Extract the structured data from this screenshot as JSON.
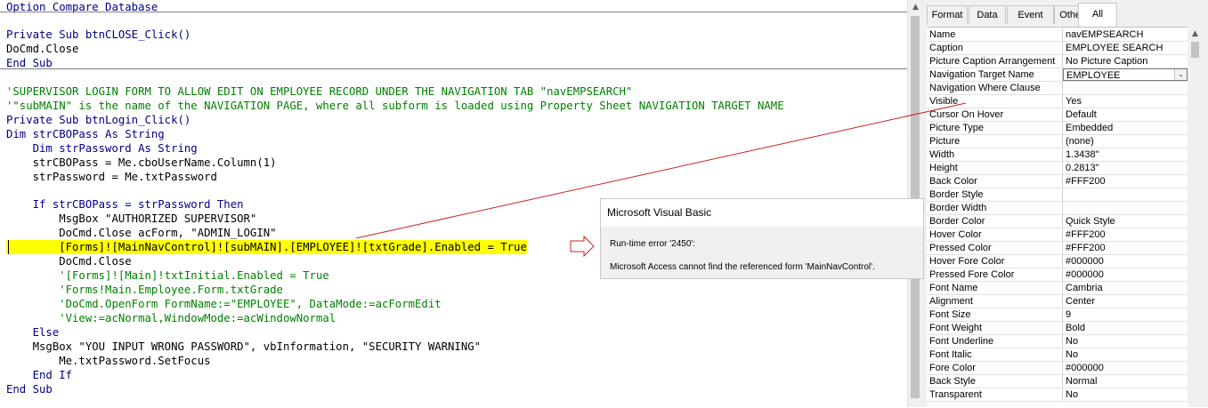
{
  "editor": {
    "lines": [
      {
        "text": "Option Compare Database",
        "style": "kw"
      },
      {
        "text": "Private Sub btnCLOSE_Click()",
        "style": "kw"
      },
      {
        "text": "DoCmd.Close",
        "style": ""
      },
      {
        "text": "End Sub",
        "style": "kw"
      },
      {
        "text": "'SUPERVISOR LOGIN FORM TO ALLOW EDIT ON EMPLOYEE RECORD UNDER THE NAVIGATION TAB \"navEMPSEARCH\"",
        "style": "cm"
      },
      {
        "text": "'\"subMAIN\" is the name of the NAVIGATION PAGE, where all subform is loaded using Property Sheet NAVIGATION TARGET NAME",
        "style": "cm"
      },
      {
        "text": "Private Sub btnLogin_Click()",
        "style": "kw"
      },
      {
        "text": "Dim strCBOPass As String",
        "style": "kw"
      },
      {
        "text": "    Dim strPassword As String",
        "style": "kw"
      },
      {
        "text": "    strCBOPass = Me.cboUserName.Column(1)",
        "style": ""
      },
      {
        "text": "    strPassword = Me.txtPassword",
        "style": ""
      },
      {
        "text": "    If strCBOPass = strPassword Then",
        "style": "kw"
      },
      {
        "text": "        MsgBox \"AUTHORIZED SUPERVISOR\"",
        "style": ""
      },
      {
        "text": "        DoCmd.Close acForm, \"ADMIN_LOGIN\"",
        "style": ""
      },
      {
        "text": "        [Forms]![MainNavControl]![subMAIN].[EMPLOYEE]![txtGrade].Enabled = True",
        "style": "hl"
      },
      {
        "text": "        DoCmd.Close",
        "style": ""
      },
      {
        "text": "        '[Forms]![Main]!txtInitial.Enabled = True",
        "style": "cm"
      },
      {
        "text": "        'Forms!Main.Employee.Form.txtGrade",
        "style": "cm"
      },
      {
        "text": "        'DoCmd.OpenForm FormName:=\"EMPLOYEE\", DataMode:=acFormEdit",
        "style": "cm"
      },
      {
        "text": "        'View:=acNormal,WindowMode:=acWindowNormal",
        "style": "cm"
      },
      {
        "text": "    Else",
        "style": "kw"
      },
      {
        "text": "    MsgBox \"YOU INPUT WRONG PASSWORD\", vbInformation, \"SECURITY WARNING\"",
        "style": ""
      },
      {
        "text": "        Me.txtPassword.SetFocus",
        "style": ""
      },
      {
        "text": "    End If",
        "style": "kw"
      },
      {
        "text": "End Sub",
        "style": "kw"
      }
    ]
  },
  "property_sheet": {
    "tabs": [
      "Format",
      "Data",
      "Event",
      "Other",
      "All"
    ],
    "active_tab": "All",
    "rows": [
      {
        "name": "Name",
        "value": "navEMPSEARCH"
      },
      {
        "name": "Caption",
        "value": "EMPLOYEE SEARCH"
      },
      {
        "name": "Picture Caption Arrangement",
        "value": "No Picture Caption"
      },
      {
        "name": "Navigation Target Name",
        "value": "EMPLOYEE"
      },
      {
        "name": "Navigation Where Clause",
        "value": ""
      },
      {
        "name": "Visible",
        "value": "Yes"
      },
      {
        "name": "Cursor On Hover",
        "value": "Default"
      },
      {
        "name": "Picture Type",
        "value": "Embedded"
      },
      {
        "name": "Picture",
        "value": "(none)"
      },
      {
        "name": "Width",
        "value": "1.3438\""
      },
      {
        "name": "Height",
        "value": "0.2813\""
      },
      {
        "name": "Back Color",
        "value": "#FFF200"
      },
      {
        "name": "Border Style",
        "value": ""
      },
      {
        "name": "Border Width",
        "value": ""
      },
      {
        "name": "Border Color",
        "value": "Quick Style"
      },
      {
        "name": "Hover Color",
        "value": "#FFF200"
      },
      {
        "name": "Pressed Color",
        "value": "#FFF200"
      },
      {
        "name": "Hover Fore Color",
        "value": "#000000"
      },
      {
        "name": "Pressed Fore Color",
        "value": "#000000"
      },
      {
        "name": "Font Name",
        "value": "Cambria"
      },
      {
        "name": "Alignment",
        "value": "Center"
      },
      {
        "name": "Font Size",
        "value": "9"
      },
      {
        "name": "Font Weight",
        "value": "Bold"
      },
      {
        "name": "Font Underline",
        "value": "No"
      },
      {
        "name": "Font Italic",
        "value": "No"
      },
      {
        "name": "Fore Color",
        "value": "#000000"
      },
      {
        "name": "Back Style",
        "value": "Normal"
      },
      {
        "name": "Transparent",
        "value": "No"
      }
    ],
    "dropdown_row": "Navigation Target Name"
  },
  "msgbox": {
    "title": "Microsoft Visual Basic",
    "error": "Run-time error '2450':",
    "message": "Microsoft Access cannot find the referenced form 'MainNavControl'."
  },
  "icons": {
    "scroll_up": "chevron-up-icon",
    "dropdown": "chevron-down-icon",
    "pointer_arrow": "arrow-right-icon"
  },
  "colors": {
    "keyword": "#00007f",
    "comment": "#008000",
    "highlight": "#ffff00",
    "annotation": "#cc2020"
  }
}
